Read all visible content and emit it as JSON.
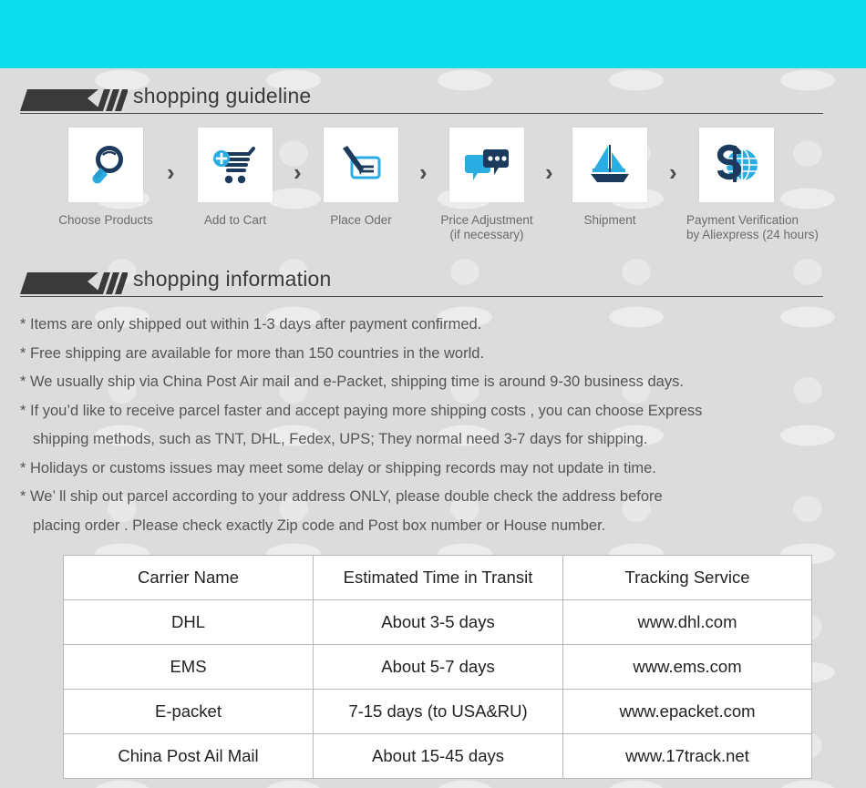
{
  "colors": {
    "banner_cyan": "#0bdcec",
    "page_background": "#dcdcdc",
    "heading_text": "#3a3a3a",
    "body_text": "#555555",
    "flag_dark": "#3a3a3a",
    "icon_dark_blue": "#1b3a5c",
    "icon_light_blue": "#29ade3",
    "table_border": "#b9b9b9"
  },
  "top_banner": {
    "name": "cyan-banner"
  },
  "sections": {
    "guideline": {
      "title": "shopping guideline",
      "steps": [
        {
          "label_line1": "Choose Products",
          "label_line2": "",
          "icon": "magnifier-icon"
        },
        {
          "label_line1": "Add to Cart",
          "label_line2": "",
          "icon": "shopping-cart-plus-icon"
        },
        {
          "label_line1": "Place Oder",
          "label_line2": "",
          "icon": "pen-check-icon"
        },
        {
          "label_line1": "Price Adjustment",
          "label_line2": "(if necessary)",
          "icon": "chat-bubbles-icon"
        },
        {
          "label_line1": "Shipment",
          "label_line2": "",
          "icon": "sailboat-icon"
        },
        {
          "label_line1": "Payment Verification",
          "label_line2": "by  Aliexpress (24 hours)",
          "icon": "dollar-globe-icon"
        }
      ],
      "arrow_glyph": "›"
    },
    "information": {
      "title": "shopping information",
      "lines": [
        {
          "text": "* Items are only shipped out within 1-3 days after payment confirmed.",
          "indent": false
        },
        {
          "text": "* Free shipping are available for more than 150 countries in the world.",
          "indent": false
        },
        {
          "text": "* We usually ship via China Post Air mail and e-Packet, shipping time is around 9-30 business days.",
          "indent": false
        },
        {
          "text": "* If you’d like to receive parcel faster and accept paying more shipping costs , you can choose Express",
          "indent": false
        },
        {
          "text": "shipping methods, such as TNT, DHL, Fedex, UPS; They normal need 3-7 days for shipping.",
          "indent": true
        },
        {
          "text": "* Holidays or customs issues may meet some delay or shipping records may not update in time.",
          "indent": false
        },
        {
          "text": "* We’ ll ship out parcel according to your address ONLY, please double check the address before",
          "indent": false
        },
        {
          "text": "placing order . Please check exactly Zip code and Post box number or House number.",
          "indent": true
        }
      ]
    }
  },
  "carrier_table": {
    "headers": [
      "Carrier Name",
      "Estimated Time in Transit",
      "Tracking Service"
    ],
    "rows": [
      [
        "DHL",
        "About 3-5 days",
        "www.dhl.com"
      ],
      [
        "EMS",
        "About 5-7 days",
        "www.ems.com"
      ],
      [
        "E-packet",
        "7-15 days (to USA&RU)",
        "www.epacket.com"
      ],
      [
        "China Post Ail Mail",
        "About 15-45 days",
        "www.17track.net"
      ]
    ]
  }
}
